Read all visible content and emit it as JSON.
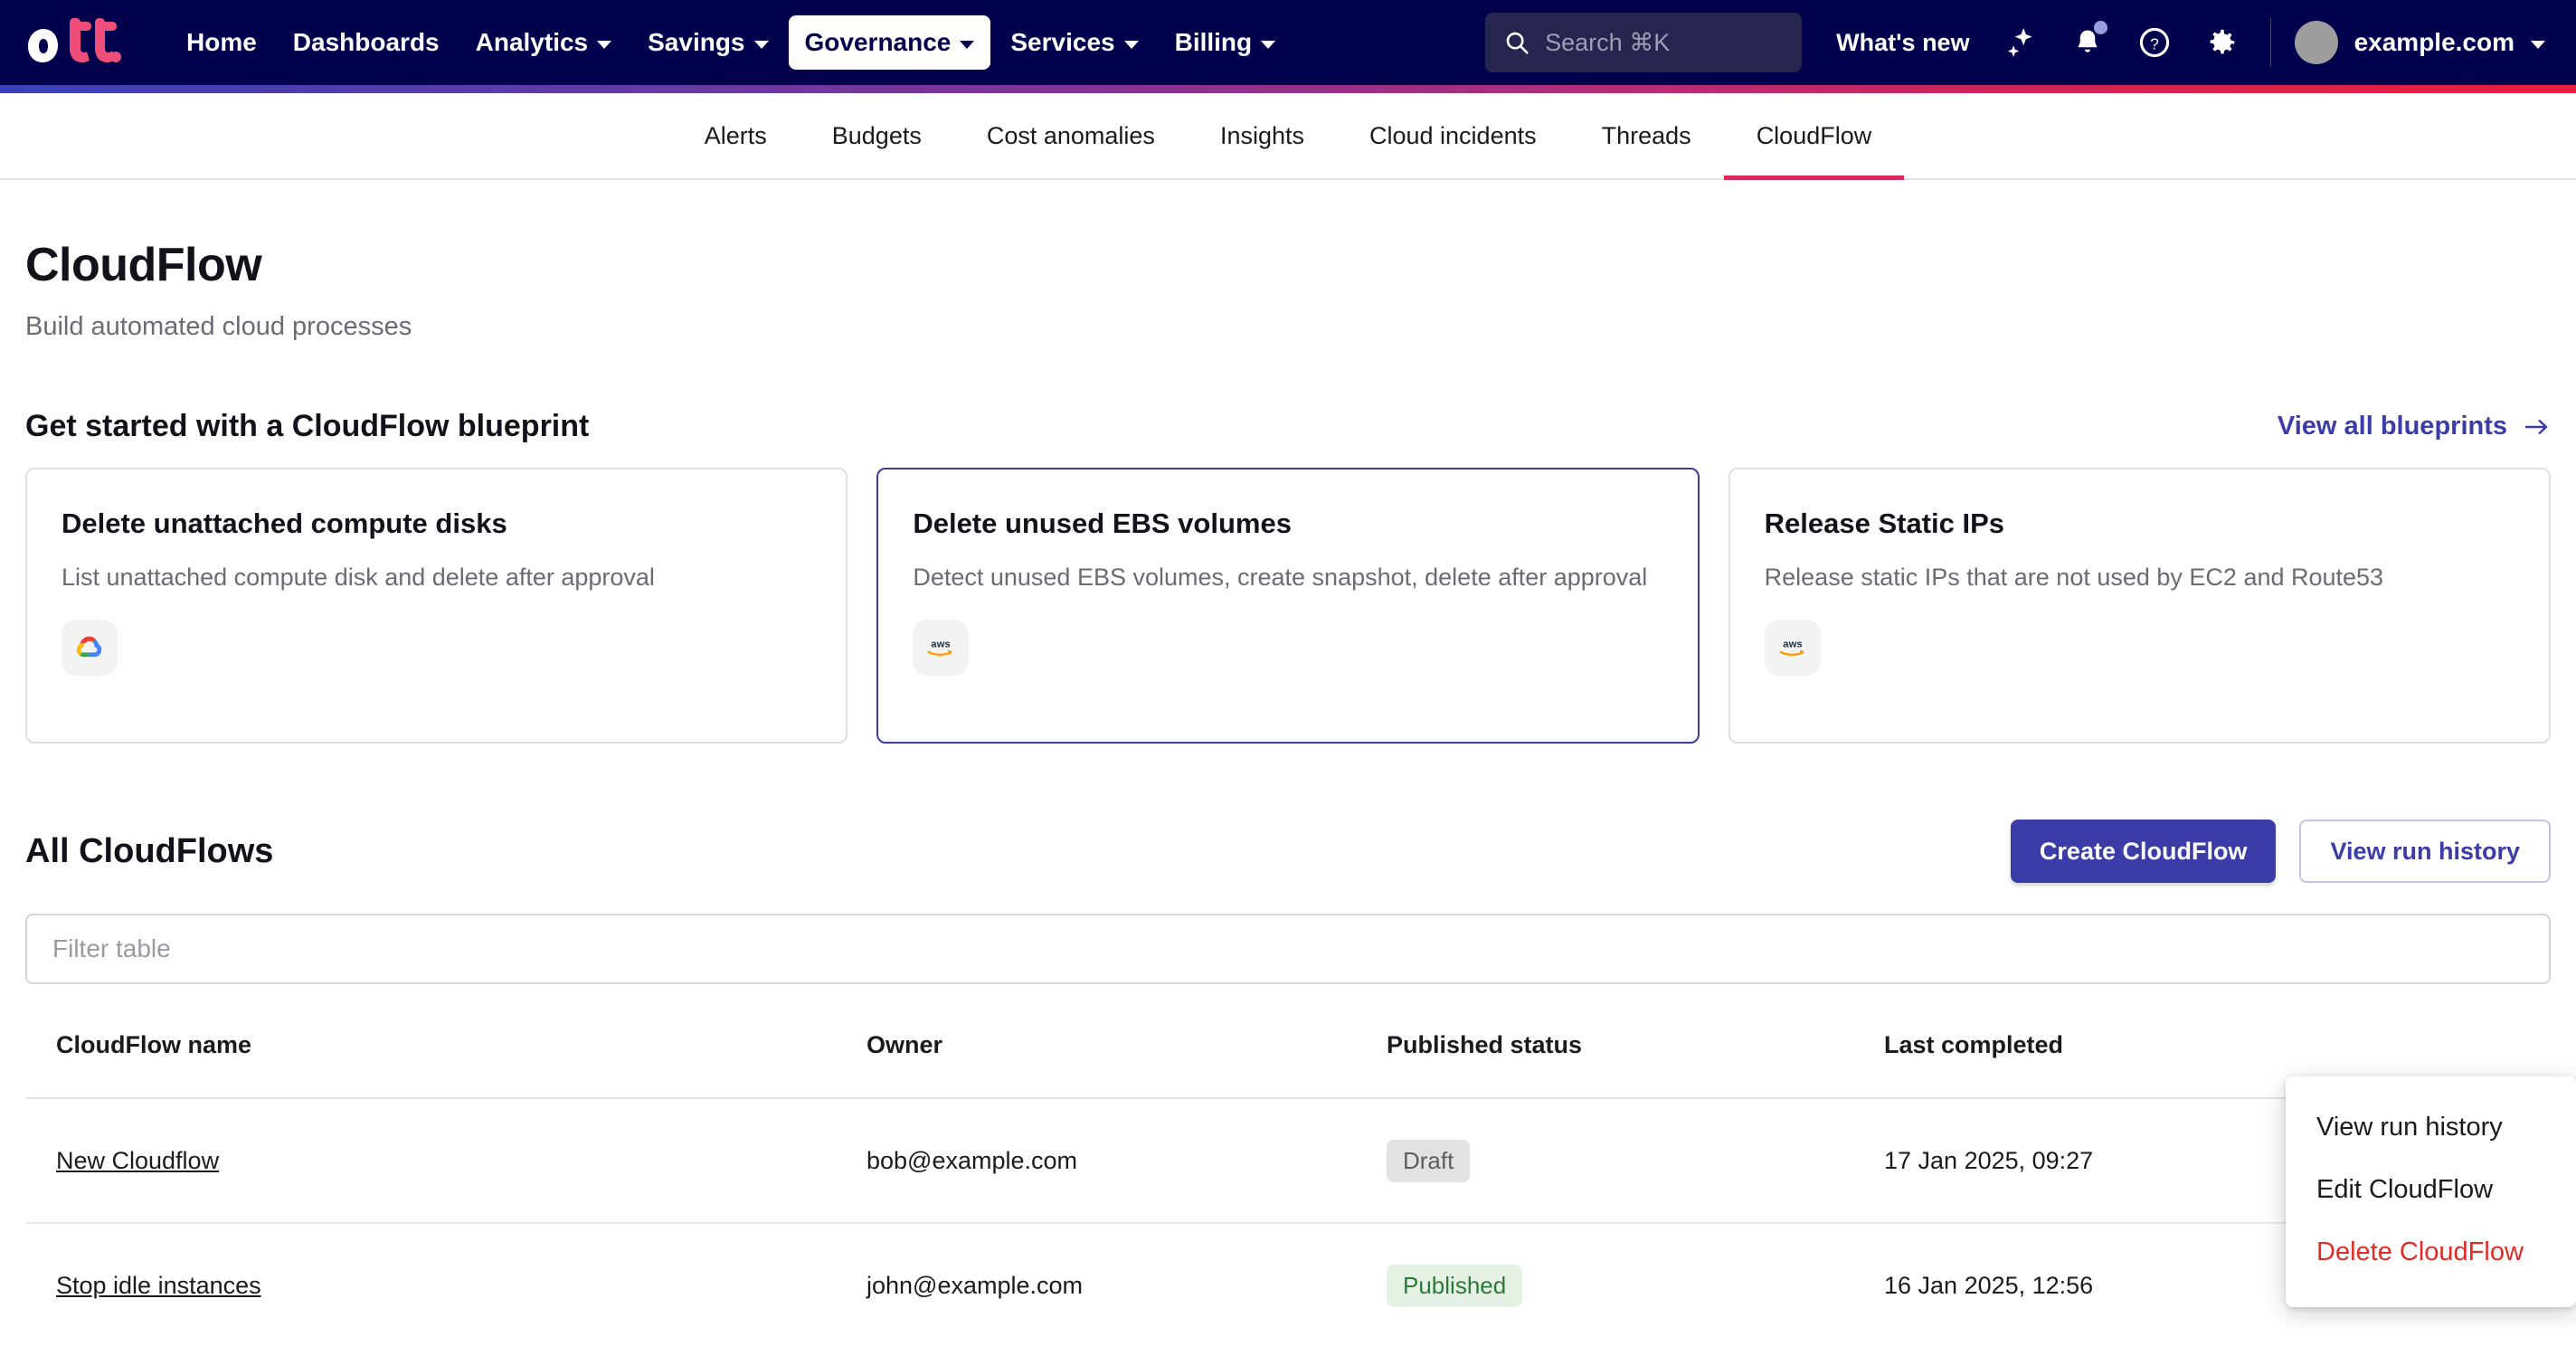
{
  "topnav": {
    "logo_text": "doit",
    "links": [
      {
        "label": "Home",
        "has_caret": false,
        "active": false
      },
      {
        "label": "Dashboards",
        "has_caret": false,
        "active": false
      },
      {
        "label": "Analytics",
        "has_caret": true,
        "active": false
      },
      {
        "label": "Savings",
        "has_caret": true,
        "active": false
      },
      {
        "label": "Governance",
        "has_caret": true,
        "active": true
      },
      {
        "label": "Services",
        "has_caret": true,
        "active": false
      },
      {
        "label": "Billing",
        "has_caret": true,
        "active": false
      }
    ],
    "search_placeholder": "Search ⌘K",
    "search_icon": "search-icon",
    "whats_new": "What's new",
    "icons": [
      "sparkle-icon",
      "bell-icon",
      "help-icon",
      "gear-icon"
    ],
    "account_name": "example.com",
    "accent_navy": "#00004d",
    "gradient_from": "#3b40b8",
    "gradient_to": "#e8203f"
  },
  "subnav": {
    "tabs": [
      {
        "label": "Alerts",
        "active": false
      },
      {
        "label": "Budgets",
        "active": false
      },
      {
        "label": "Cost anomalies",
        "active": false
      },
      {
        "label": "Insights",
        "active": false
      },
      {
        "label": "Cloud incidents",
        "active": false
      },
      {
        "label": "Threads",
        "active": false
      },
      {
        "label": "CloudFlow",
        "active": true
      }
    ],
    "active_underline_color": "#d62b5b"
  },
  "page": {
    "title": "CloudFlow",
    "subtitle": "Build automated cloud processes"
  },
  "blueprints": {
    "heading": "Get started with a CloudFlow blueprint",
    "view_all": "View all blueprints",
    "view_all_icon": "arrow-right-icon",
    "cards": [
      {
        "title": "Delete unattached compute disks",
        "description": "List unattached compute disk and delete after approval",
        "cloud": "gcp",
        "selected": false
      },
      {
        "title": "Delete unused EBS volumes",
        "description": "Detect unused EBS volumes, create snapshot, delete after approval",
        "cloud": "aws",
        "selected": true
      },
      {
        "title": "Release Static IPs",
        "description": "Release static IPs that are not used by EC2 and Route53",
        "cloud": "aws",
        "selected": false
      }
    ]
  },
  "all_cloudflows": {
    "heading": "All CloudFlows",
    "create_button": "Create CloudFlow",
    "history_button": "View run history",
    "filter_placeholder": "Filter table",
    "columns": [
      "CloudFlow name",
      "Owner",
      "Published status",
      "Last completed"
    ],
    "rows": [
      {
        "name": "New Cloudflow",
        "owner": "bob@example.com",
        "status": "Draft",
        "status_kind": "draft",
        "last_completed": "17 Jan 2025, 09:27"
      },
      {
        "name": "Stop idle instances",
        "owner": "john@example.com",
        "status": "Published",
        "status_kind": "published",
        "last_completed": "16 Jan 2025, 12:56"
      }
    ]
  },
  "context_menu": {
    "items": [
      {
        "label": "View run history",
        "danger": false
      },
      {
        "label": "Edit CloudFlow",
        "danger": false
      },
      {
        "label": "Delete CloudFlow",
        "danger": true
      }
    ],
    "danger_color": "#e02b27"
  }
}
